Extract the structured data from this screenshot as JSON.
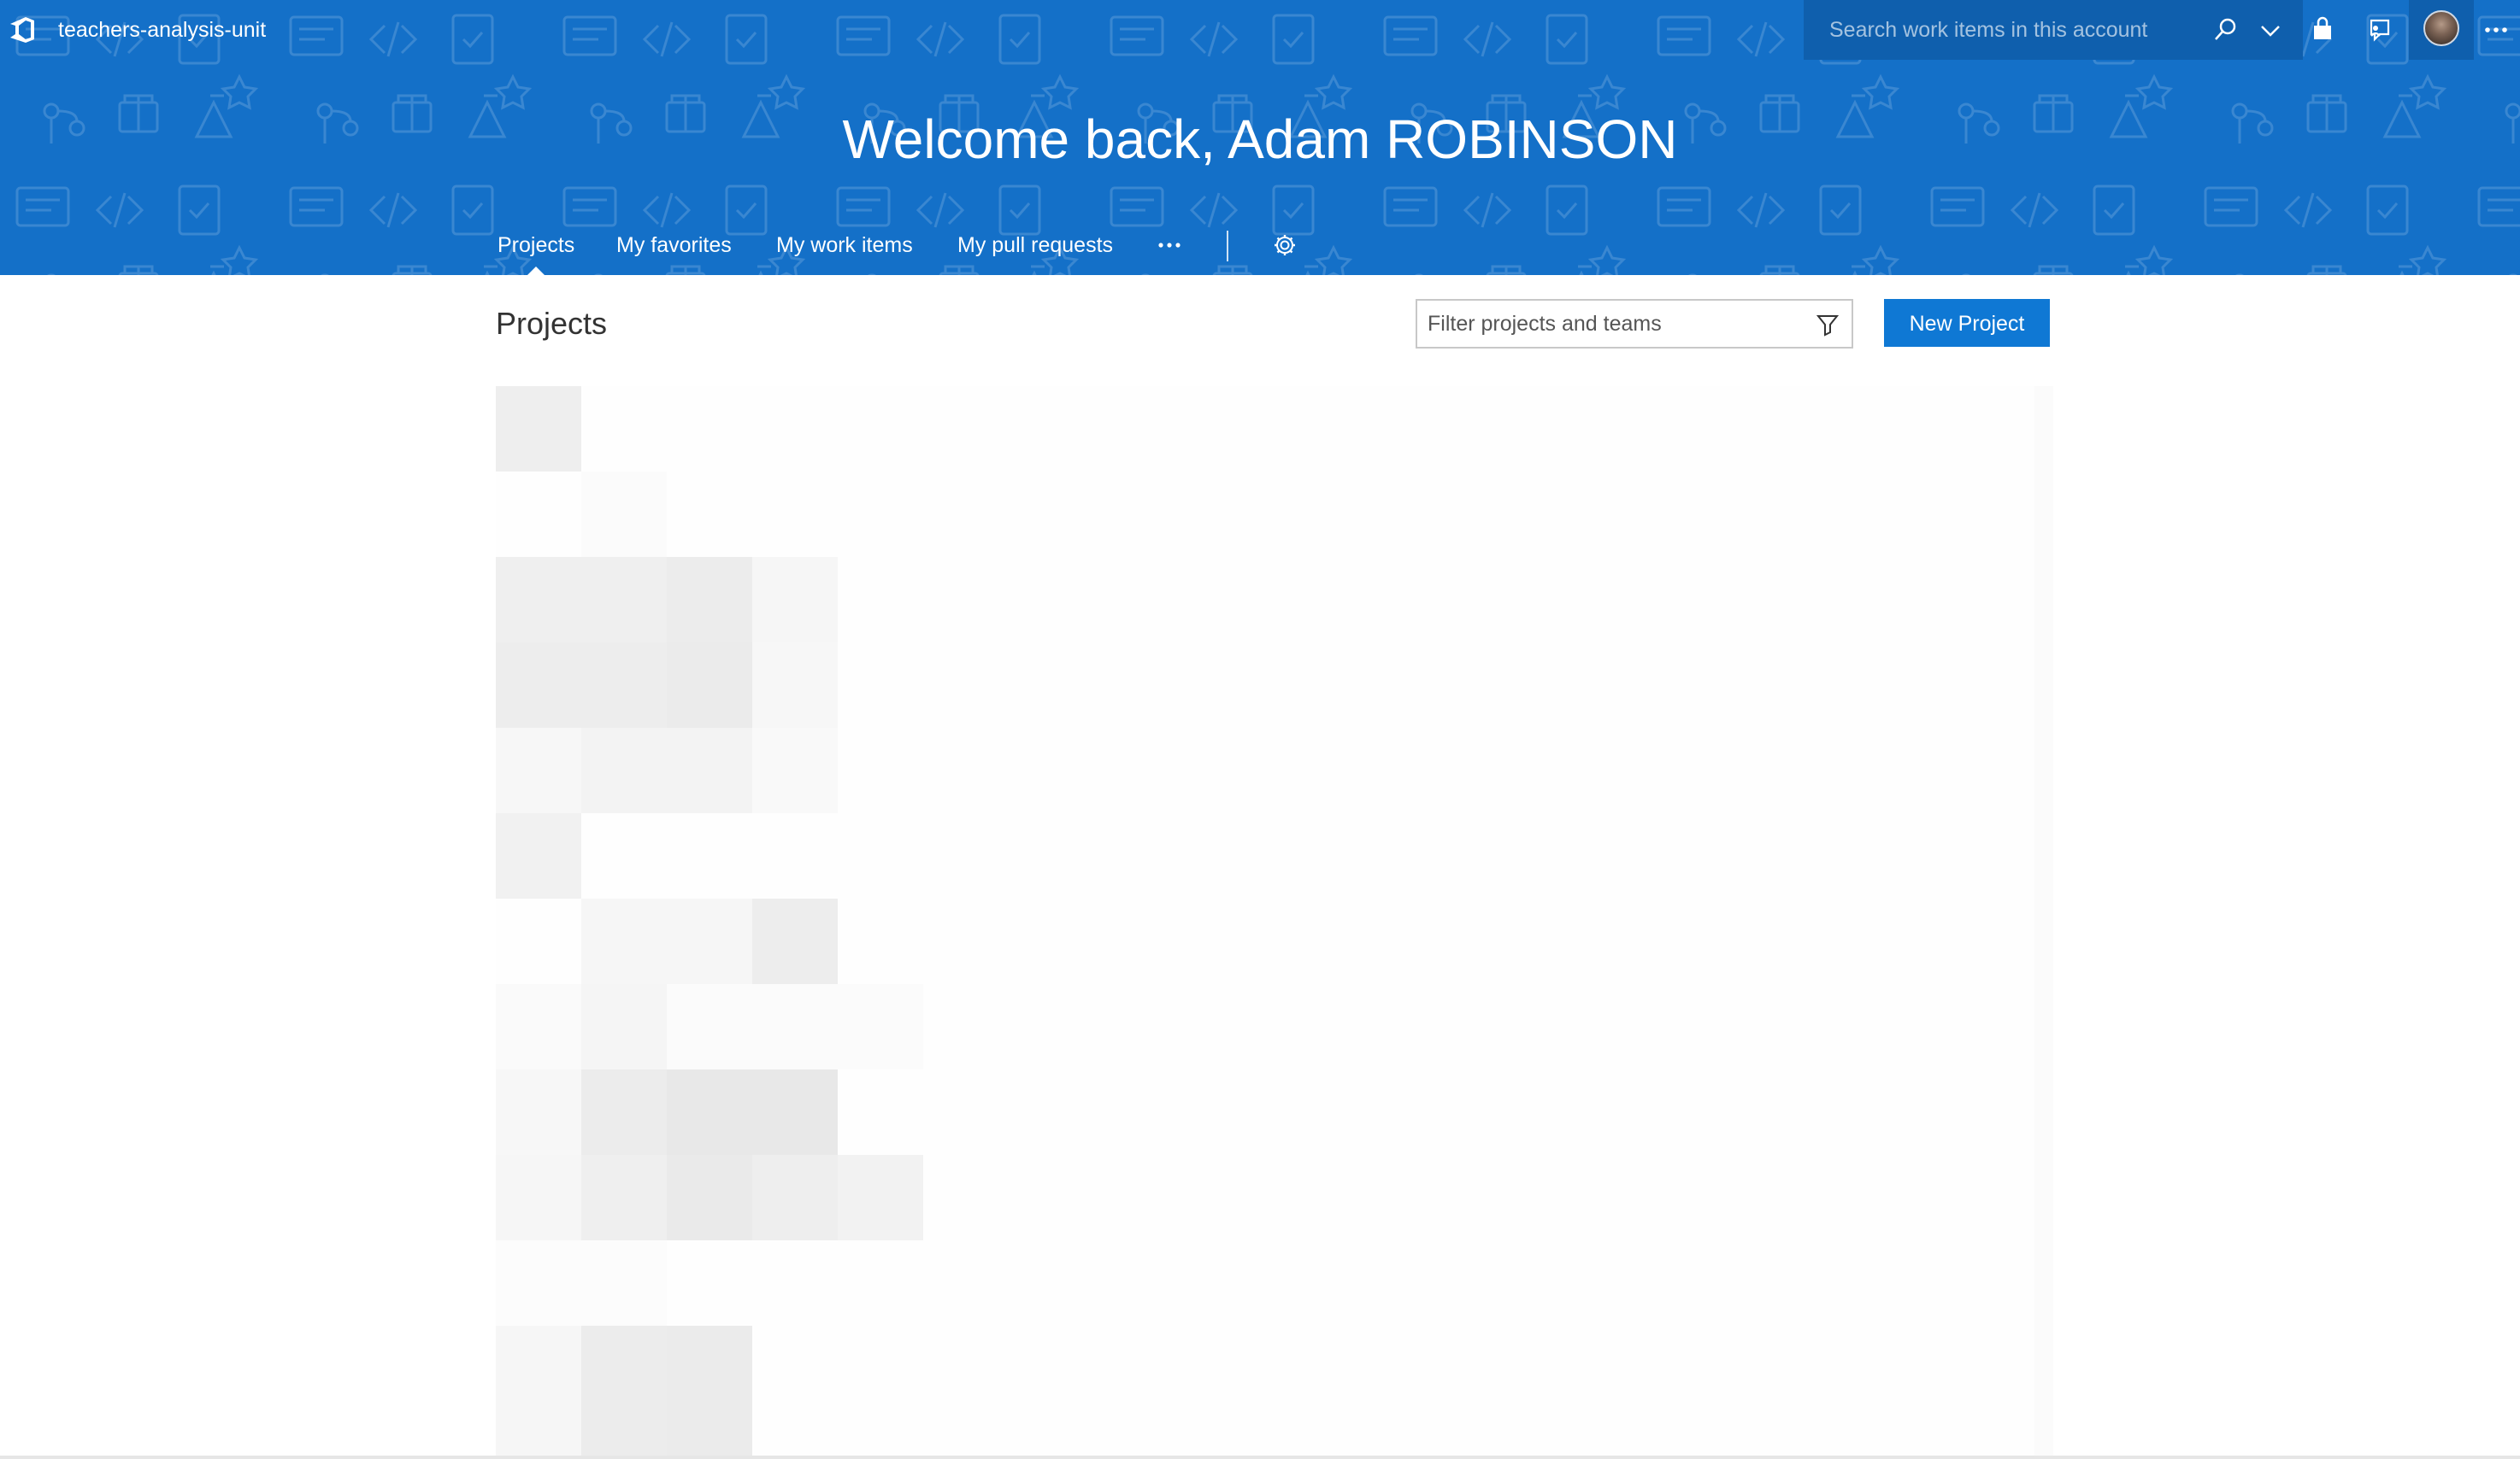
{
  "topbar": {
    "account_name": "teachers-analysis-unit",
    "search": {
      "placeholder": "Search work items in this account",
      "value": ""
    },
    "icons": [
      "azure-devops-logo-icon",
      "search-icon",
      "chevron-down-icon",
      "shopping-bag-icon",
      "feedback-icon",
      "avatar",
      "more-icon"
    ]
  },
  "header": {
    "welcome_text": "Welcome back, Adam ROBINSON",
    "background_color": "#1470c8"
  },
  "nav": {
    "items": [
      {
        "label": "Projects",
        "selected": true
      },
      {
        "label": "My favorites",
        "selected": false
      },
      {
        "label": "My work items",
        "selected": false
      },
      {
        "label": "My pull requests",
        "selected": false
      }
    ],
    "more_icon": "ellipsis-icon",
    "settings_icon": "gear-icon"
  },
  "main": {
    "title": "Projects",
    "filter": {
      "placeholder": "Filter projects and teams",
      "value": ""
    },
    "new_project_label": "New Project",
    "accent_color": "#0f78d4",
    "content_state": "blurred-placeholder"
  }
}
